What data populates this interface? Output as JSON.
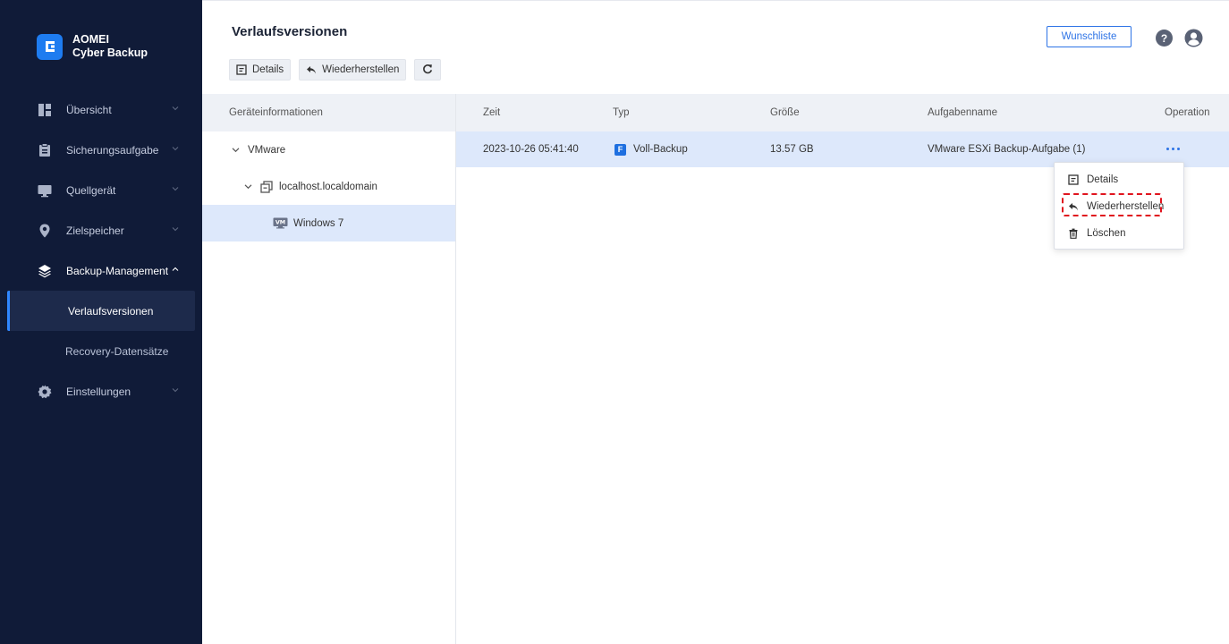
{
  "app": {
    "brand_line1": "AOMEI",
    "brand_line2": "Cyber Backup"
  },
  "sidebar": {
    "items": [
      {
        "label": "Übersicht",
        "icon": "dashboard-icon"
      },
      {
        "label": "Sicherungsaufgabe",
        "icon": "clipboard-icon"
      },
      {
        "label": "Quellgerät",
        "icon": "monitor-icon"
      },
      {
        "label": "Zielspeicher",
        "icon": "location-pin-icon"
      },
      {
        "label": "Backup-Management",
        "icon": "layers-icon"
      },
      {
        "label": "Einstellungen",
        "icon": "gear-icon"
      }
    ],
    "subitems": [
      {
        "label": "Verlaufsversionen",
        "active": true
      },
      {
        "label": "Recovery-Datensätze",
        "active": false
      }
    ]
  },
  "header": {
    "title": "Verlaufsversionen",
    "wishlist_label": "Wunschliste"
  },
  "toolbar": {
    "details_label": "Details",
    "restore_label": "Wiederherstellen",
    "refresh_icon": "refresh-icon"
  },
  "tree": {
    "header": "Geräteinformationen",
    "nodes": [
      {
        "label": "VMware",
        "level": 0
      },
      {
        "label": "localhost.localdomain",
        "level": 1
      },
      {
        "label": "Windows 7",
        "level": 2,
        "badge": "VM"
      }
    ]
  },
  "table": {
    "columns": [
      "Zeit",
      "Typ",
      "Größe",
      "Aufgabenname",
      "Operation"
    ],
    "rows": [
      {
        "time": "2023-10-26 05:41:40",
        "type_badge": "F",
        "type": "Voll-Backup",
        "size": "13.57 GB",
        "task": "VMware ESXi Backup-Aufgabe (1)"
      }
    ]
  },
  "context_menu": {
    "items": [
      {
        "label": "Details",
        "icon": "details-icon"
      },
      {
        "label": "Wiederherstellen",
        "icon": "restore-icon"
      },
      {
        "label": "Löschen",
        "icon": "trash-icon"
      }
    ]
  },
  "colors": {
    "sidebar_bg": "#101b38",
    "accent": "#2d73e6",
    "selected_row": "#dde8fb",
    "highlight_border": "#e0141e"
  }
}
